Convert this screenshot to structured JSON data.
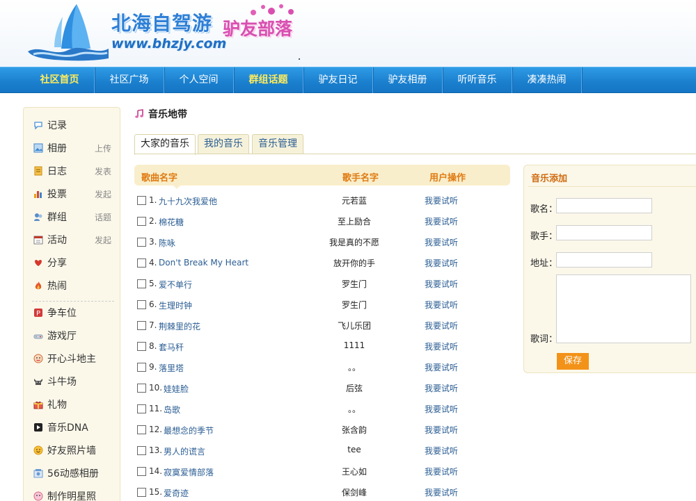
{
  "header": {
    "logo_title": "北海自驾游",
    "logo_url": "www.bhzjy.com",
    "logo_tribe": "驴友部落"
  },
  "nav": {
    "items": [
      {
        "label": "社区首页"
      },
      {
        "label": "社区广场"
      },
      {
        "label": "个人空间"
      },
      {
        "label": "群组话题"
      },
      {
        "label": "驴友日记"
      },
      {
        "label": "驴友相册"
      },
      {
        "label": "听听音乐"
      },
      {
        "label": "凑凑热闹"
      }
    ]
  },
  "sidebar": {
    "items": [
      {
        "label": "记录",
        "extra": "",
        "icon": "chat-bubble-icon",
        "color": "#4a8fd8"
      },
      {
        "label": "相册",
        "extra": "上传",
        "icon": "photo-icon",
        "color": "#3f86cc"
      },
      {
        "label": "日志",
        "extra": "发表",
        "icon": "notebook-icon",
        "color": "#e8a21c"
      },
      {
        "label": "投票",
        "extra": "发起",
        "icon": "bar-chart-icon",
        "color": "#d8452f"
      },
      {
        "label": "群组",
        "extra": "话题",
        "icon": "group-icon",
        "color": "#5a8fc8"
      },
      {
        "label": "活动",
        "extra": "发起",
        "icon": "calendar-icon",
        "color": "#7d7d7d"
      },
      {
        "label": "分享",
        "extra": "",
        "icon": "heart-icon",
        "color": "#d8372b"
      },
      {
        "label": "热闹",
        "extra": "",
        "icon": "fire-icon",
        "color": "#e4572a"
      },
      {
        "label": "争车位",
        "extra": "",
        "icon": "parking-icon",
        "color": "#d23a3a"
      },
      {
        "label": "游戏厅",
        "extra": "",
        "icon": "joystick-icon",
        "color": "#8a9bb0"
      },
      {
        "label": "开心斗地主",
        "extra": "",
        "icon": "poker-face-icon",
        "color": "#d26a3c"
      },
      {
        "label": "斗牛场",
        "extra": "",
        "icon": "bull-icon",
        "color": "#555"
      },
      {
        "label": "礼物",
        "extra": "",
        "icon": "gift-icon",
        "color": "#c8342f"
      },
      {
        "label": "音乐DNA",
        "extra": "",
        "icon": "play-icon",
        "color": "#222"
      },
      {
        "label": "好友照片墙",
        "extra": "",
        "icon": "smiley-icon",
        "color": "#f0b42a"
      },
      {
        "label": "56动感相册",
        "extra": "",
        "icon": "film-icon",
        "color": "#6b9bd1"
      },
      {
        "label": "制作明星照",
        "extra": "",
        "icon": "star-face-icon",
        "color": "#d86a8a"
      }
    ]
  },
  "main": {
    "title": "音乐地带",
    "tabs": [
      {
        "label": "大家的音乐"
      },
      {
        "label": "我的音乐"
      },
      {
        "label": "音乐管理"
      }
    ],
    "columns": {
      "song": "歌曲名字",
      "singer": "歌手名字",
      "action": "用户操作"
    },
    "rows": [
      {
        "num": "1.",
        "song": "九十九次我爱他",
        "singer": "元若蓝",
        "action": "我要试听"
      },
      {
        "num": "2.",
        "song": "棉花糖",
        "singer": "至上励合",
        "action": "我要试听"
      },
      {
        "num": "3.",
        "song": "陈咏",
        "singer": "我是真的不愿",
        "action": "我要试听"
      },
      {
        "num": "4.",
        "song": "Don't Break My Heart",
        "singer": "放开你的手",
        "action": "我要试听"
      },
      {
        "num": "5.",
        "song": "爱不单行",
        "singer": "罗生门",
        "action": "我要试听"
      },
      {
        "num": "6.",
        "song": "生理时钟",
        "singer": "罗生门",
        "action": "我要试听"
      },
      {
        "num": "7.",
        "song": "荆棘里的花",
        "singer": "飞儿乐团",
        "action": "我要试听"
      },
      {
        "num": "8.",
        "song": "套马秆",
        "singer": "1111",
        "action": "我要试听"
      },
      {
        "num": "9.",
        "song": "落里塔",
        "singer": "。。",
        "action": "我要试听"
      },
      {
        "num": "10.",
        "song": "娃娃脸",
        "singer": "后弦",
        "action": "我要试听"
      },
      {
        "num": "11.",
        "song": "岛歌",
        "singer": "。。",
        "action": "我要试听"
      },
      {
        "num": "12.",
        "song": "最想念的季节",
        "singer": "张含韵",
        "action": "我要试听"
      },
      {
        "num": "13.",
        "song": "男人的谎言",
        "singer": "tee",
        "action": "我要试听"
      },
      {
        "num": "14.",
        "song": "寂寞爱情部落",
        "singer": "王心如",
        "action": "我要试听"
      },
      {
        "num": "15.",
        "song": "爱奇迹",
        "singer": "保剑峰",
        "action": "我要试听"
      }
    ]
  },
  "panel": {
    "title": "音乐添加",
    "song_label": "歌名：",
    "singer_label": "歌手：",
    "url_label": "地址：",
    "lyrics_label": "歌词：",
    "save_label": "保存"
  }
}
